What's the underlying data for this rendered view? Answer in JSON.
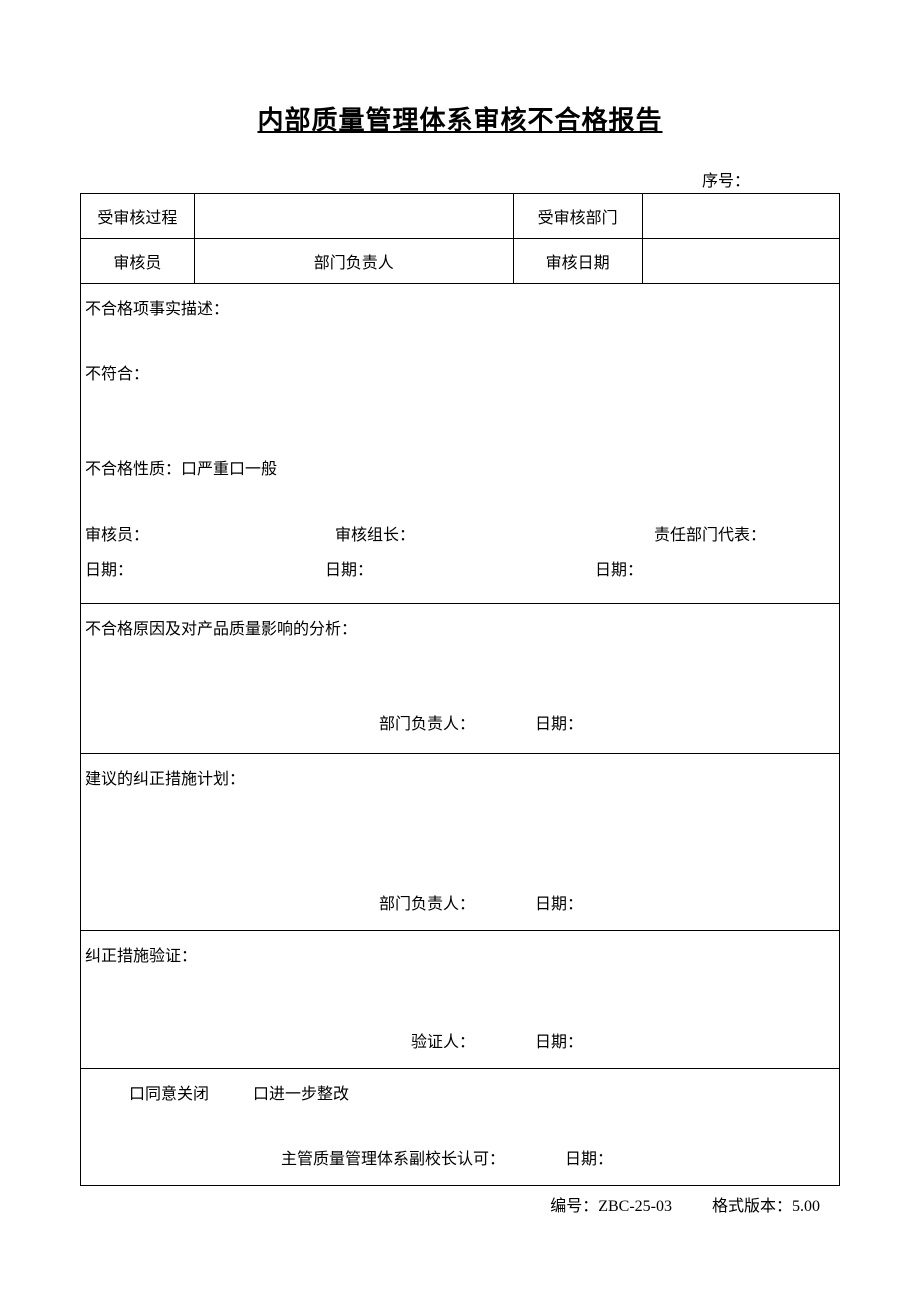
{
  "title": "内部质量管理体系审核不合格报告",
  "seq_label": "序号：",
  "row1": {
    "audited_process_label": "受审核过程",
    "audited_process_value": "",
    "audited_dept_label": "受审核部门",
    "audited_dept_value": ""
  },
  "row2": {
    "auditor_label": "审核员",
    "dept_head_label": "部门负责人",
    "audit_date_label": "审核日期",
    "audit_date_value": ""
  },
  "desc_block": {
    "fact_label": "不合格项事实描述：",
    "nonconform_label": "不符合：",
    "nature_label": "不合格性质：口严重口一般",
    "sig_auditor": "审核员：",
    "sig_leader": "审核组长：",
    "sig_dept_rep": "责任部门代表：",
    "date_label": "日期："
  },
  "cause_block": {
    "label": "不合格原因及对产品质量影响的分析：",
    "sig_dept_head": "部门负责人：",
    "date_label": "日期："
  },
  "plan_block": {
    "label": "建议的纠正措施计划：",
    "sig_dept_head": "部门负责人：",
    "date_label": "日期："
  },
  "verify_block": {
    "label": "纠正措施验证：",
    "sig_verifier": "验证人：",
    "date_label": "日期："
  },
  "close_block": {
    "opt_agree": "口同意关闭",
    "opt_further": "口进一步整改",
    "approve_label": "主管质量管理体系副校长认可：",
    "date_label": "日期："
  },
  "footer": {
    "code_label": "编号：",
    "code_value": "ZBC-25-03",
    "ver_label": "格式版本：",
    "ver_value": "5.00"
  }
}
